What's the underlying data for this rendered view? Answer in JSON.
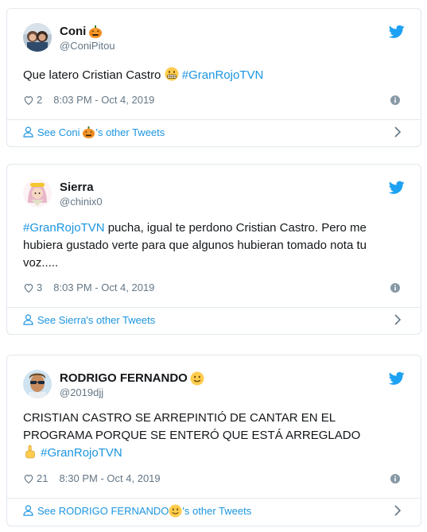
{
  "tweets": [
    {
      "name": "Coni",
      "name_emoji": "pumpkin-emoji",
      "handle": "@ConiPitou",
      "text": "Que latero Cristian Castro",
      "text_emoji": "grimacing-face-emoji",
      "hashtag": "#GranRojoTVN",
      "likes": "2",
      "time": "8:03 PM - Oct 4, 2019",
      "footer_prefix": "See Coni",
      "footer_suffix": "'s other Tweets"
    },
    {
      "name": "Sierra",
      "handle": "@chinix0",
      "hashtag": "#GranRojoTVN",
      "text_line1": " pucha, igual te perdono Cristian Castro. Pero me",
      "text_line2": "hubiera gustado verte para que algunos hubieran tomado nota tu",
      "text_line3": "voz.....",
      "likes": "3",
      "time": "8:03 PM - Oct 4, 2019",
      "footer": "See Sierra's other Tweets"
    },
    {
      "name": "RODRIGO FERNANDO",
      "name_emoji": "smiling-face-emoji",
      "handle": "@2019djj",
      "text_line1": "CRISTIAN CASTRO SE ARREPINTIÓ DE CANTAR EN EL",
      "text_line2": "PROGRAMA PORQUE SE ENTERÓ QUE ESTÁ ARREGLADO",
      "text_emoji": "pointing-up-emoji",
      "hashtag": "#GranRojoTVN",
      "likes": "21",
      "time": "8:30 PM - Oct 4, 2019",
      "footer_prefix": "See RODRIGO FERNANDO",
      "footer_suffix": "'s other Tweets"
    }
  ],
  "colors": {
    "twitter_blue": "#1da1f2",
    "link": "#1b95e0",
    "muted": "#657786",
    "border": "#e1e8ed"
  }
}
